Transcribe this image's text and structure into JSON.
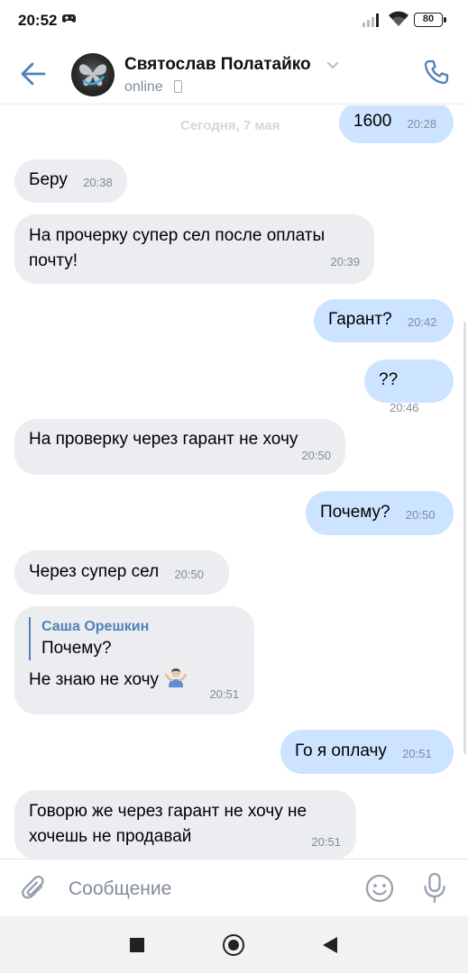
{
  "status_bar": {
    "time": "20:52",
    "battery": "80"
  },
  "header": {
    "contact_name": "Святослав Полатайко",
    "contact_status": "online"
  },
  "chat": {
    "date_separator": "Сегодня, 7 мая",
    "messages": [
      {
        "direction": "out",
        "text": "1600",
        "time": "20:28"
      },
      {
        "direction": "in",
        "text": "Беру",
        "time": "20:38"
      },
      {
        "direction": "in",
        "text": "На прочерку супер сел после оплаты почту!",
        "time": "20:39"
      },
      {
        "direction": "out",
        "text": "Гарант?",
        "time": "20:42"
      },
      {
        "direction": "out",
        "text": "??",
        "time": "20:46"
      },
      {
        "direction": "in",
        "text": "На проверку через гарант не хочу",
        "time": "20:50"
      },
      {
        "direction": "out",
        "text": "Почему?",
        "time": "20:50"
      },
      {
        "direction": "in",
        "text": "Через супер сел",
        "time": "20:50"
      },
      {
        "direction": "in",
        "reply_author": "Саша Орешкин",
        "reply_text": "Почему?",
        "text": "Не знаю не хочу",
        "emoji": "man-shrugging-emoji",
        "time": "20:51"
      },
      {
        "direction": "out",
        "text": "Го я оплачу",
        "time": "20:51"
      },
      {
        "direction": "in",
        "text": "Говорю же через гарант не хочу не хочешь не продавай",
        "time": "20:51"
      }
    ]
  },
  "composer": {
    "placeholder": "Сообщение"
  },
  "colors": {
    "accent": "#5181b8",
    "incoming_bubble": "#ebedf0",
    "outgoing_bubble": "#cce4ff",
    "secondary_text": "#818c99"
  },
  "icons": [
    "back-arrow-icon",
    "chevron-down-icon",
    "phone-small-icon",
    "call-icon",
    "attach-icon",
    "emoji-icon",
    "mic-icon"
  ]
}
